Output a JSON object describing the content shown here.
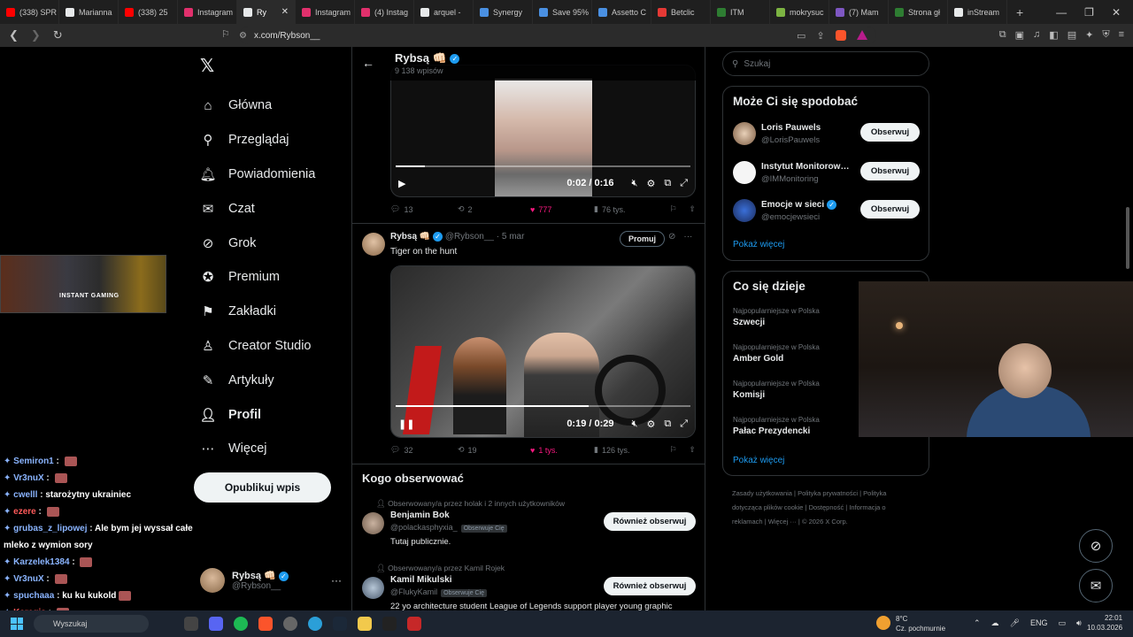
{
  "browser": {
    "tabs": [
      {
        "label": "(338) SPR",
        "color": "#ff0000"
      },
      {
        "label": "Marianna",
        "color": "#e7e9ea"
      },
      {
        "label": "(338) 25",
        "color": "#ff0000"
      },
      {
        "label": "Instagram",
        "color": "#e1306c"
      },
      {
        "label": "Ry",
        "color": "#e7e9ea",
        "active": true
      },
      {
        "label": "Instagram",
        "color": "#e1306c"
      },
      {
        "label": "(4) Instag",
        "color": "#e1306c"
      },
      {
        "label": "arquel -",
        "color": "#e7e9ea"
      },
      {
        "label": "Synergy",
        "color": "#4a90e2"
      },
      {
        "label": "Save 95%",
        "color": "#4a90e2"
      },
      {
        "label": "Assetto C",
        "color": "#4a90e2"
      },
      {
        "label": "Betclic",
        "color": "#e53935"
      },
      {
        "label": "ITM",
        "color": "#2e7d32"
      },
      {
        "label": "mokrysuc",
        "color": "#7cb342"
      },
      {
        "label": "(7) Mam",
        "color": "#7e57c2"
      },
      {
        "label": "Strona gł",
        "color": "#2e7d32"
      },
      {
        "label": "inStream",
        "color": "#e7e9ea"
      }
    ],
    "url": "x.com/Rybson__"
  },
  "stream": {
    "banner_text": "INSTANT GAMING",
    "chat": [
      {
        "name": "Semiron1",
        "msg": "",
        "emote": true,
        "red": false
      },
      {
        "name": "Vr3nuX",
        "msg": "",
        "emote": true,
        "red": false
      },
      {
        "name": "cwelll",
        "msg": "starożytny ukrainiec",
        "emote": false,
        "red": false
      },
      {
        "name": "ezere",
        "msg": "",
        "emote": true,
        "red": true
      },
      {
        "name": "grubas_z_lipowej",
        "msg": "Ale bym jej wyssał całe",
        "emote": false,
        "red": false
      },
      {
        "name": "",
        "msg": "mleko z wymion sory",
        "emote": false,
        "red": false
      },
      {
        "name": "Karzelek1384",
        "msg": "",
        "emote": true,
        "red": false
      },
      {
        "name": "Vr3nuX",
        "msg": "",
        "emote": true,
        "red": false
      },
      {
        "name": "spuchaaa",
        "msg": "ku ku kukold",
        "emote": true,
        "red": false
      },
      {
        "name": "Karegis",
        "msg": "",
        "emote": true,
        "red": true
      }
    ]
  },
  "nav": {
    "items": [
      {
        "label": "Główna",
        "icon": "⌂",
        "name": "home"
      },
      {
        "label": "Przeglądaj",
        "icon": "⚲",
        "name": "explore"
      },
      {
        "label": "Powiadomienia",
        "icon": "🔔︎",
        "name": "notifications"
      },
      {
        "label": "Czat",
        "icon": "✉",
        "name": "chat"
      },
      {
        "label": "Grok",
        "icon": "⊘",
        "name": "grok"
      },
      {
        "label": "Premium",
        "icon": "✪",
        "name": "premium"
      },
      {
        "label": "Zakładki",
        "icon": "⚑",
        "name": "bookmarks"
      },
      {
        "label": "Creator Studio",
        "icon": "♙",
        "name": "creator-studio"
      },
      {
        "label": "Artykuły",
        "icon": "✎",
        "name": "articles"
      },
      {
        "label": "Profil",
        "icon": "👤︎",
        "name": "profile"
      },
      {
        "label": "Więcej",
        "icon": "⋯",
        "name": "more"
      }
    ],
    "post_button": "Opublikuj wpis",
    "me": {
      "name": "Rybsą 👊🏻",
      "handle": "@Rybson__"
    }
  },
  "profile": {
    "name": "Rybsą 👊🏻",
    "posts_count": "9 138 wpisów"
  },
  "tweet1": {
    "time": "0:02 / 0:16",
    "progress": 0.1,
    "replies": "13",
    "reposts": "2",
    "likes": "777",
    "views": "76 tys."
  },
  "tweet2": {
    "author": "Rybsą 👊🏻",
    "handle": "@Rybson__",
    "date": "· 5 mar",
    "promote": "Promuj",
    "text": "Tiger on the hunt",
    "time": "0:19 / 0:29",
    "progress": 0.6551,
    "replies": "32",
    "reposts": "19",
    "likes": "1 tys.",
    "views": "126 tys."
  },
  "who_to_follow": {
    "title": "Kogo obserwować",
    "users": [
      {
        "context": "Obserwowany/a przez holak i 2 innych użytkowników",
        "name": "Benjamin Bok",
        "handle": "@polackasphyxia_",
        "badge": "Obserwuje Cię",
        "bio": "Tutaj publicznie.",
        "button": "Również obserwuj"
      },
      {
        "context": "Obserwowany/a przez Kamil Rojek",
        "name": "Kamil Mikulski",
        "handle": "@FlukyKamil",
        "badge": "Obserwuje Cię",
        "bio": "22 yo architecture student League of Legends support player young graphic",
        "button": "Również obserwuj"
      }
    ]
  },
  "right": {
    "search_placeholder": "Szukaj",
    "suggest_title": "Może Ci się spodobać",
    "suggestions": [
      {
        "name": "Loris Pauwels",
        "handle": "@LorisPauwels",
        "button": "Obserwuj"
      },
      {
        "name": "Instytut Monitorowania",
        "handle": "@IMMonitoring",
        "button": "Obserwuj"
      },
      {
        "name": "Emocje w sieci",
        "handle": "@emocjewsieci",
        "button": "Obserwuj"
      }
    ],
    "show_more": "Pokaż więcej",
    "trends_title": "Co się dzieje",
    "trends": [
      {
        "context": "Najpopularniejsze w Polska",
        "topic": "Szwecji"
      },
      {
        "context": "Najpopularniejsze w Polska",
        "topic": "Amber Gold"
      },
      {
        "context": "Najpopularniejsze w Polska",
        "topic": "Komisji"
      },
      {
        "context": "Najpopularniejsze w Polska",
        "topic": "Pałac Prezydencki"
      }
    ],
    "trends_more": "Pokaż więcej",
    "footer": [
      "Zasady użytkowania",
      "Polityka prywatności",
      "Polityka dotycząca plików cookie",
      "Dostępność",
      "Informacja o reklamach",
      "Więcej ···",
      "© 2026 X Corp."
    ]
  },
  "taskbar": {
    "search": "Wyszukaj",
    "weather_temp": "8°C",
    "weather_desc": "Cz. pochmurnie",
    "lang": "ENG",
    "time": "22:01",
    "date": "10.03.2026"
  }
}
